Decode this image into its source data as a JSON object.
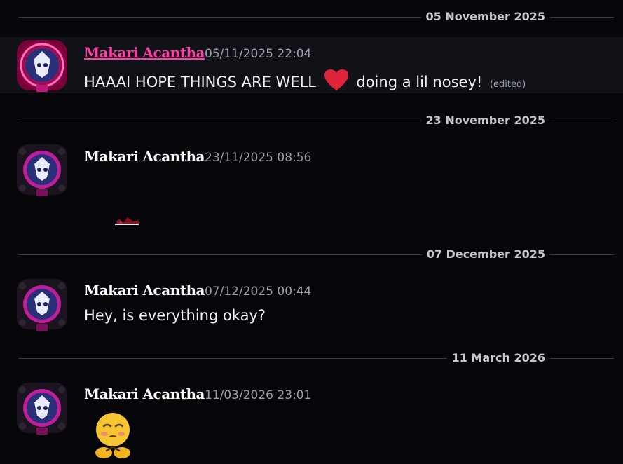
{
  "colors": {
    "background": "#06060a",
    "divider_line": "#3a3b44",
    "author_pink": "#ff3ea5",
    "timestamp": "#9aa0ab"
  },
  "dividers": [
    "05 November 2025",
    "23 November 2025",
    "07 December 2025",
    "11 March 2026"
  ],
  "messages": [
    {
      "author": "Makari Acantha",
      "timestamp": "05/11/2025 22:04",
      "text_before": "HAAAI HOPE THINGS ARE WELL",
      "emoji": "heart-emoji",
      "text_after": "doing a lil nosey!",
      "edited": "(edited)"
    },
    {
      "author": "Makari Acantha",
      "timestamp": "23/11/2025 08:56",
      "sticker": "red-sticker"
    },
    {
      "author": "Makari Acantha",
      "timestamp": "07/12/2025 00:44",
      "text": "Hey, is everything okay?"
    },
    {
      "author": "Makari Acantha",
      "timestamp": "11/03/2026 23:01",
      "sticker": "shy-emoji-sticker"
    }
  ]
}
